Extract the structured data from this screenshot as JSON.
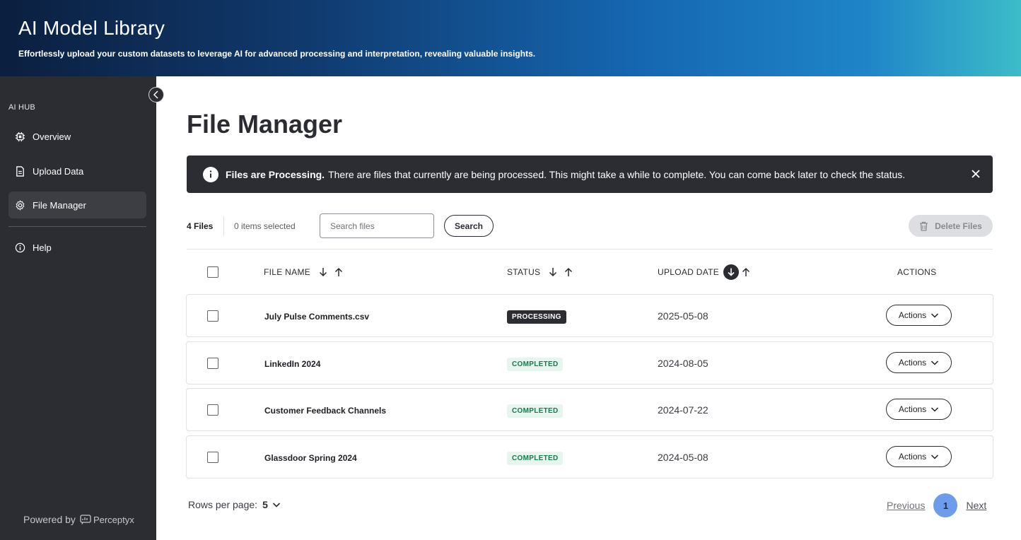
{
  "header": {
    "title": "AI Model Library",
    "subtitle": "Effortlessly upload your custom datasets to leverage AI for advanced processing and interpretation, revealing valuable insights."
  },
  "sidebar": {
    "section_label": "AI HUB",
    "items": [
      {
        "label": "Overview",
        "icon": "chip-icon"
      },
      {
        "label": "Upload Data",
        "icon": "document-icon"
      },
      {
        "label": "File Manager",
        "icon": "gear-icon",
        "active": true
      },
      {
        "label": "Help",
        "icon": "info-icon"
      }
    ],
    "powered_by": "Powered by",
    "brand": "Perceptyx"
  },
  "main": {
    "page_title": "File Manager",
    "alert": {
      "title": "Files are Processing.",
      "message": "There are files that currently are being processed. This might take a while to complete. You can come back later to check the status."
    },
    "toolbar": {
      "files_count": "4 Files",
      "selected_count": "0 items selected",
      "search_placeholder": "Search files",
      "search_value": "",
      "search_label": "Search",
      "delete_label": "Delete Files"
    },
    "table": {
      "columns": {
        "file_name": "FILE NAME",
        "status": "STATUS",
        "upload_date": "UPLOAD DATE",
        "actions": "ACTIONS"
      },
      "rows": [
        {
          "file_name": "July Pulse Comments.csv",
          "status": "PROCESSING",
          "upload_date": "2025-05-08",
          "action_label": "Actions"
        },
        {
          "file_name": "LinkedIn 2024",
          "status": "COMPLETED",
          "upload_date": "2024-08-05",
          "action_label": "Actions"
        },
        {
          "file_name": "Customer Feedback Channels",
          "status": "COMPLETED",
          "upload_date": "2024-07-22",
          "action_label": "Actions"
        },
        {
          "file_name": "Glassdoor Spring 2024",
          "status": "COMPLETED",
          "upload_date": "2024-05-08",
          "action_label": "Actions"
        }
      ]
    },
    "pagination": {
      "rows_per_page_label": "Rows per page:",
      "rows_per_page_value": "5",
      "previous": "Previous",
      "current_page": "1",
      "next": "Next"
    }
  },
  "colors": {
    "sidebar_bg": "#2b2d33",
    "header_gradient_start": "#0b1f3f",
    "header_gradient_end": "#3cbcc8",
    "completed_text": "#167a4e",
    "completed_bg": "#e6f6ef",
    "page_active": "#6d9ceb"
  }
}
